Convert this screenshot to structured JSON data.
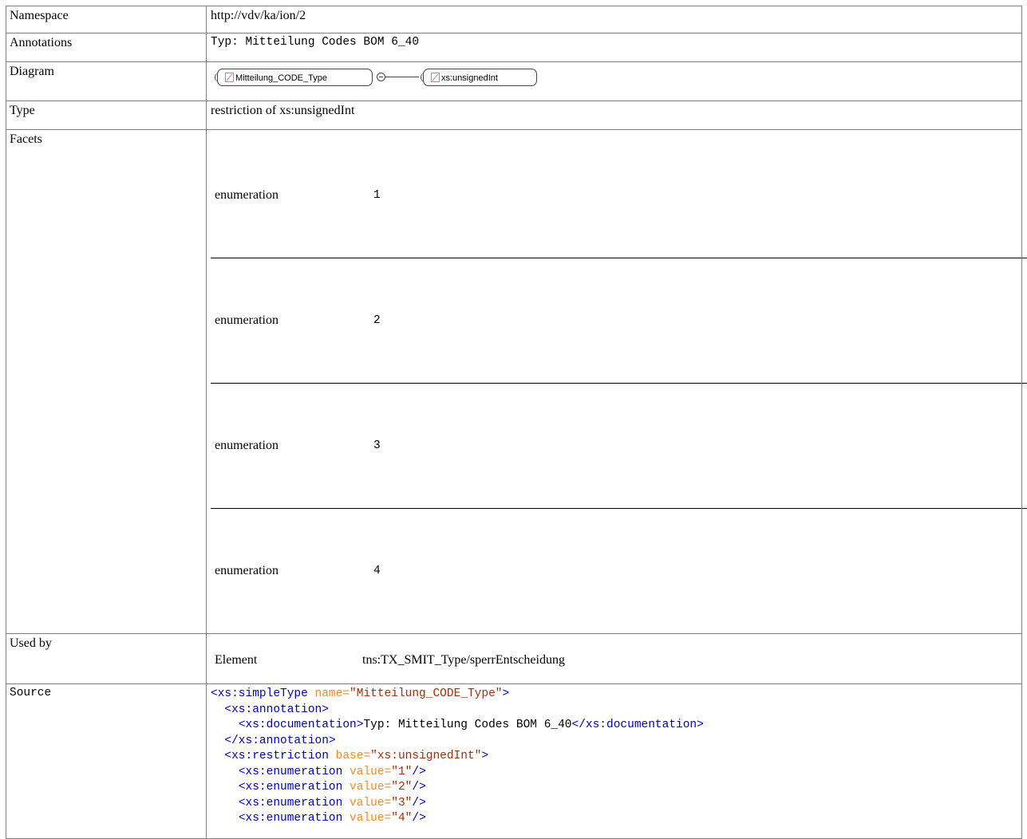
{
  "rows": {
    "namespace": {
      "label": "Namespace",
      "value": "http://vdv/ka/ion/2"
    },
    "annotations": {
      "label": "Annotations",
      "value": "Typ: Mitteilung Codes BOM 6_40"
    },
    "diagram": {
      "label": "Diagram",
      "type_box": "Mitteilung_CODE_Type",
      "base_box": "xs:unsignedInt"
    },
    "type": {
      "label": "Type",
      "value": "restriction of xs:unsignedInt"
    },
    "facets": {
      "label": "Facets",
      "items": [
        {
          "name": "enumeration",
          "value": "1"
        },
        {
          "name": "enumeration",
          "value": "2"
        },
        {
          "name": "enumeration",
          "value": "3"
        },
        {
          "name": "enumeration",
          "value": "4"
        }
      ]
    },
    "used_by": {
      "label": "Used by",
      "kind": "Element",
      "ref": "tns:TX_SMIT_Type/sperrEntscheidung"
    },
    "source": {
      "label": "Source",
      "lines": [
        [
          {
            "c": "tg",
            "t": "<xs:simpleType "
          },
          {
            "c": "at",
            "t": "name="
          },
          {
            "c": "av",
            "t": "\"Mitteilung_CODE_Type\""
          },
          {
            "c": "tg",
            "t": ">"
          }
        ],
        [
          {
            "c": "tx",
            "t": "  "
          },
          {
            "c": "tg",
            "t": "<xs:annotation>"
          }
        ],
        [
          {
            "c": "tx",
            "t": "    "
          },
          {
            "c": "tg",
            "t": "<xs:documentation>"
          },
          {
            "c": "tx",
            "t": "Typ: Mitteilung Codes BOM 6_40"
          },
          {
            "c": "tg",
            "t": "</xs:documentation>"
          }
        ],
        [
          {
            "c": "tx",
            "t": "  "
          },
          {
            "c": "tg",
            "t": "</xs:annotation>"
          }
        ],
        [
          {
            "c": "tx",
            "t": "  "
          },
          {
            "c": "tg",
            "t": "<xs:restriction "
          },
          {
            "c": "at",
            "t": "base="
          },
          {
            "c": "av",
            "t": "\"xs:unsignedInt\""
          },
          {
            "c": "tg",
            "t": ">"
          }
        ],
        [
          {
            "c": "tx",
            "t": "    "
          },
          {
            "c": "tg",
            "t": "<xs:enumeration "
          },
          {
            "c": "at",
            "t": "value="
          },
          {
            "c": "av",
            "t": "\"1\""
          },
          {
            "c": "tg",
            "t": "/>"
          }
        ],
        [
          {
            "c": "tx",
            "t": "    "
          },
          {
            "c": "tg",
            "t": "<xs:enumeration "
          },
          {
            "c": "at",
            "t": "value="
          },
          {
            "c": "av",
            "t": "\"2\""
          },
          {
            "c": "tg",
            "t": "/>"
          }
        ],
        [
          {
            "c": "tx",
            "t": "    "
          },
          {
            "c": "tg",
            "t": "<xs:enumeration "
          },
          {
            "c": "at",
            "t": "value="
          },
          {
            "c": "av",
            "t": "\"3\""
          },
          {
            "c": "tg",
            "t": "/>"
          }
        ],
        [
          {
            "c": "tx",
            "t": "    "
          },
          {
            "c": "tg",
            "t": "<xs:enumeration "
          },
          {
            "c": "at",
            "t": "value="
          },
          {
            "c": "av",
            "t": "\"4\""
          },
          {
            "c": "tg",
            "t": "/>"
          }
        ]
      ]
    }
  },
  "colors": {
    "border": "#808080",
    "tag": "#0000b4",
    "attr_name": "#f08c28",
    "attr_value": "#a0300a"
  }
}
